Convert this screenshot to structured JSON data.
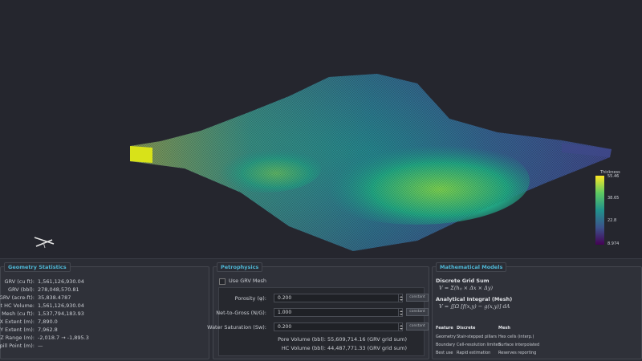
{
  "colorbar": {
    "title": "Thickness",
    "ticks": [
      "55.46",
      "38.65",
      "22.8",
      "8.974"
    ]
  },
  "geometry": {
    "title": "Geometry Statistics",
    "rows": [
      {
        "label": "GRV (cu ft):",
        "value": "1,561,126,930.04"
      },
      {
        "label": "GRV (bbl):",
        "value": "278,048,570.81"
      },
      {
        "label": "GRV (acre-ft):",
        "value": "35,838.4787"
      },
      {
        "label": "Net HC Volume:",
        "value": "1,561,126,930.04"
      },
      {
        "label": "GRV Mesh (cu ft):",
        "value": "1,537,794,183.93"
      },
      {
        "label": "X Extent (m):",
        "value": "7,890.0"
      },
      {
        "label": "Y Extent (m):",
        "value": "7,962.8"
      },
      {
        "label": "Z Range (m):",
        "value": "-2,018.7 → -1,895.3"
      },
      {
        "label": "Spill Point (m):",
        "value": "—"
      }
    ]
  },
  "petro": {
    "title": "Petrophysics",
    "use_mesh_label": "Use GRV Mesh",
    "fields": [
      {
        "label": "Porosity (φ):",
        "value": "0.200",
        "mode": "constant"
      },
      {
        "label": "Net-to-Gross (N/G):",
        "value": "1.000",
        "mode": "constant"
      },
      {
        "label": "Water Saturation (Sw):",
        "value": "0.200",
        "mode": "constant"
      }
    ],
    "pore_volume": "Pore Volume (bbl): 55,609,714.16 (GRV grid sum)",
    "hc_volume": "HC Volume (bbl): 44,487,771.33 (GRV grid sum)"
  },
  "math": {
    "title": "Mathematical Models",
    "discrete_head": "Discrete Grid Sum",
    "discrete_eq": "V = Σ(hᵢⱼ × Δx × Δy)",
    "analytic_head": "Analytical Integral (Mesh)",
    "analytic_eq": "V = ∬Ω [f(x,y) − g(x,y)] dA",
    "table_headers": [
      "Feature",
      "Discrete",
      "Mesh"
    ],
    "table_rows": [
      [
        "Geometry",
        "Stair-stepped pillars",
        "Hex cells (interp.)"
      ],
      [
        "Boundary",
        "Cell-resolution limited",
        "Surface interpolated"
      ],
      [
        "Best use",
        "Rapid estimation",
        "Reserves reporting"
      ]
    ]
  }
}
